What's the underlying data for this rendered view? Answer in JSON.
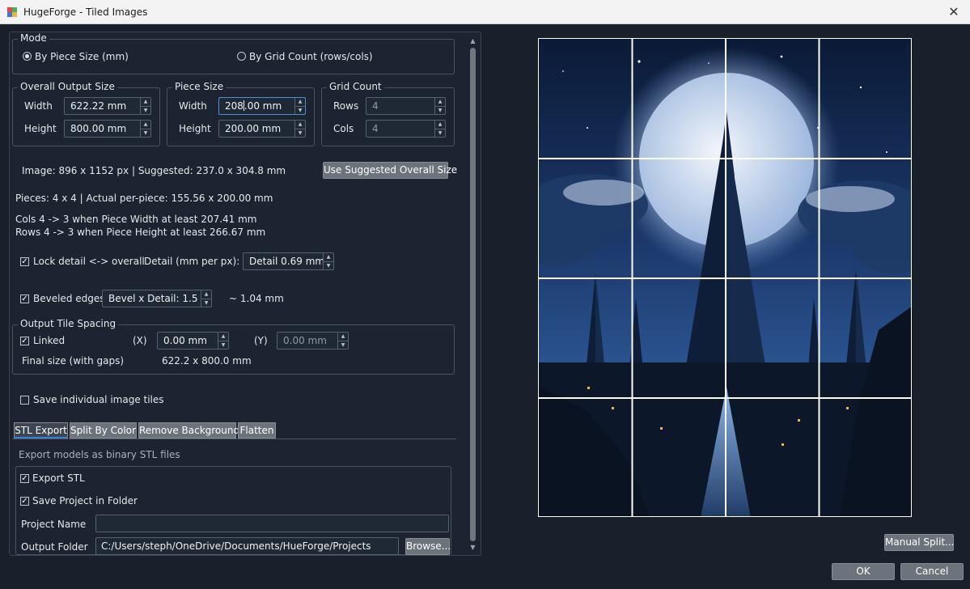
{
  "window": {
    "title": "HugeForge - Tiled Images",
    "close_glyph": "✕"
  },
  "mode": {
    "title": "Mode",
    "options": [
      {
        "label": "By Piece Size (mm)",
        "checked": true
      },
      {
        "label": "By Grid Count (rows/cols)",
        "checked": false
      }
    ]
  },
  "overall_output_size": {
    "title": "Overall Output Size",
    "width_label": "Width",
    "width_value": "622.22 mm",
    "height_label": "Height",
    "height_value": "800.00 mm"
  },
  "piece_size": {
    "title": "Piece Size",
    "width_label": "Width",
    "width_value_before_caret": "208",
    "width_value_after_caret": ".00 mm",
    "height_label": "Height",
    "height_value": "200.00 mm"
  },
  "grid_count": {
    "title": "Grid Count",
    "rows_label": "Rows",
    "rows_value": "4",
    "cols_label": "Cols",
    "cols_value": "4"
  },
  "info": {
    "image_line": "Image: 896 x 1152 px | Suggested: 237.0 x 304.8 mm",
    "use_suggested_button": "Use Suggested Overall Size",
    "pieces_line": "Pieces: 4 x 4 | Actual per-piece: 155.56 x 200.00 mm",
    "cols_hint": "Cols 4 -> 3 when Piece Width at least 207.41 mm",
    "rows_hint": "Rows 4 -> 3 when Piece Height at least 266.67 mm"
  },
  "lock_detail": {
    "label": "Lock detail <-> overall",
    "checked": true,
    "detail_label": "Detail (mm per px):",
    "detail_value": "Detail 0.69 mm"
  },
  "beveled": {
    "label": "Beveled edges",
    "checked": true,
    "bevel_value": "Bevel x Detail: 1.5",
    "result": "~ 1.04 mm"
  },
  "spacing": {
    "title": "Output Tile Spacing",
    "linked_label": "Linked",
    "linked_checked": true,
    "x_label": "(X)",
    "x_value": "0.00 mm",
    "y_label": "(Y)",
    "y_value": "0.00 mm",
    "final_label": "Final size (with gaps)",
    "final_value": "622.2 x 800.0 mm"
  },
  "save_tiles": {
    "label": "Save individual image tiles",
    "checked": false
  },
  "tabs": [
    {
      "label": "STL Export",
      "active": true
    },
    {
      "label": "Split By Color",
      "active": false
    },
    {
      "label": "Remove Background",
      "active": false
    },
    {
      "label": "Flatten",
      "active": false
    }
  ],
  "stl_export": {
    "description": "Export models as binary STL files",
    "export_stl_label": "Export STL",
    "export_stl_checked": true,
    "save_project_label": "Save Project in Folder",
    "save_project_checked": true,
    "project_name_label": "Project Name",
    "project_name_value": "",
    "output_folder_label": "Output Folder",
    "output_folder_value": "C:/Users/steph/OneDrive/Documents/HueForge/Projects",
    "browse_button": "Browse..."
  },
  "preview": {
    "grid_rows": 4,
    "grid_cols": 4
  },
  "buttons": {
    "manual_split": "Manual Split...",
    "ok": "OK",
    "cancel": "Cancel"
  },
  "glyphs": {
    "check": "✓",
    "up": "▲",
    "down": "▼"
  }
}
